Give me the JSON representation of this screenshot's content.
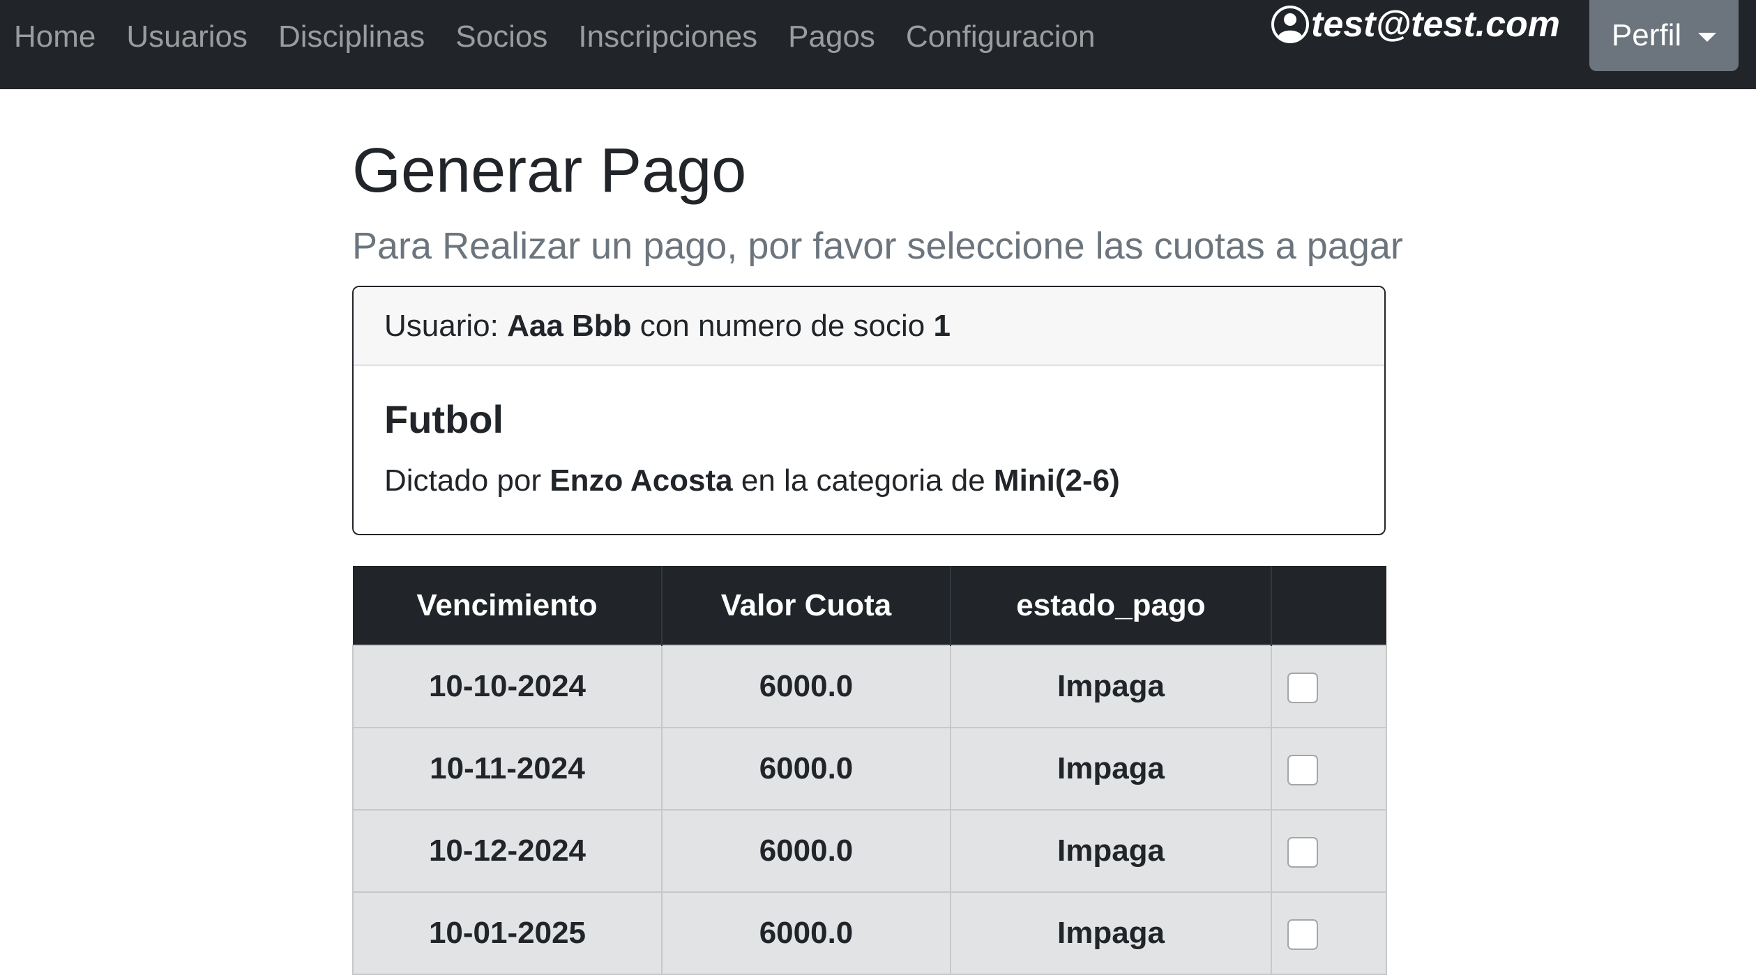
{
  "navbar": {
    "links": [
      "Home",
      "Usuarios",
      "Disciplinas",
      "Socios",
      "Inscripciones",
      "Pagos",
      "Configuracion"
    ],
    "user_email": "test@test.com",
    "user_icon": "person-circle-icon",
    "profile_label": "Perfil",
    "background_color": "#212529"
  },
  "page": {
    "title": "Generar Pago",
    "subtitle": "Para Realizar un pago, por favor seleccione las cuotas a pagar"
  },
  "card": {
    "user_prefix": "Usuario: ",
    "user_name": "Aaa Bbb",
    "member_text": " con numero de socio ",
    "member_number": "1",
    "discipline": "Futbol",
    "taught_prefix": "Dictado por ",
    "teacher": "Enzo Acosta",
    "category_text": " en la categoria de ",
    "category": "Mini(2-6)"
  },
  "table": {
    "headers": [
      "Vencimiento",
      "Valor Cuota",
      "estado_pago",
      ""
    ],
    "rows": [
      {
        "due": "10-10-2024",
        "amount": "6000.0",
        "status": "Impaga",
        "checked": false
      },
      {
        "due": "10-11-2024",
        "amount": "6000.0",
        "status": "Impaga",
        "checked": false
      },
      {
        "due": "10-12-2024",
        "amount": "6000.0",
        "status": "Impaga",
        "checked": false
      },
      {
        "due": "10-01-2025",
        "amount": "6000.0",
        "status": "Impaga",
        "checked": false
      }
    ]
  }
}
